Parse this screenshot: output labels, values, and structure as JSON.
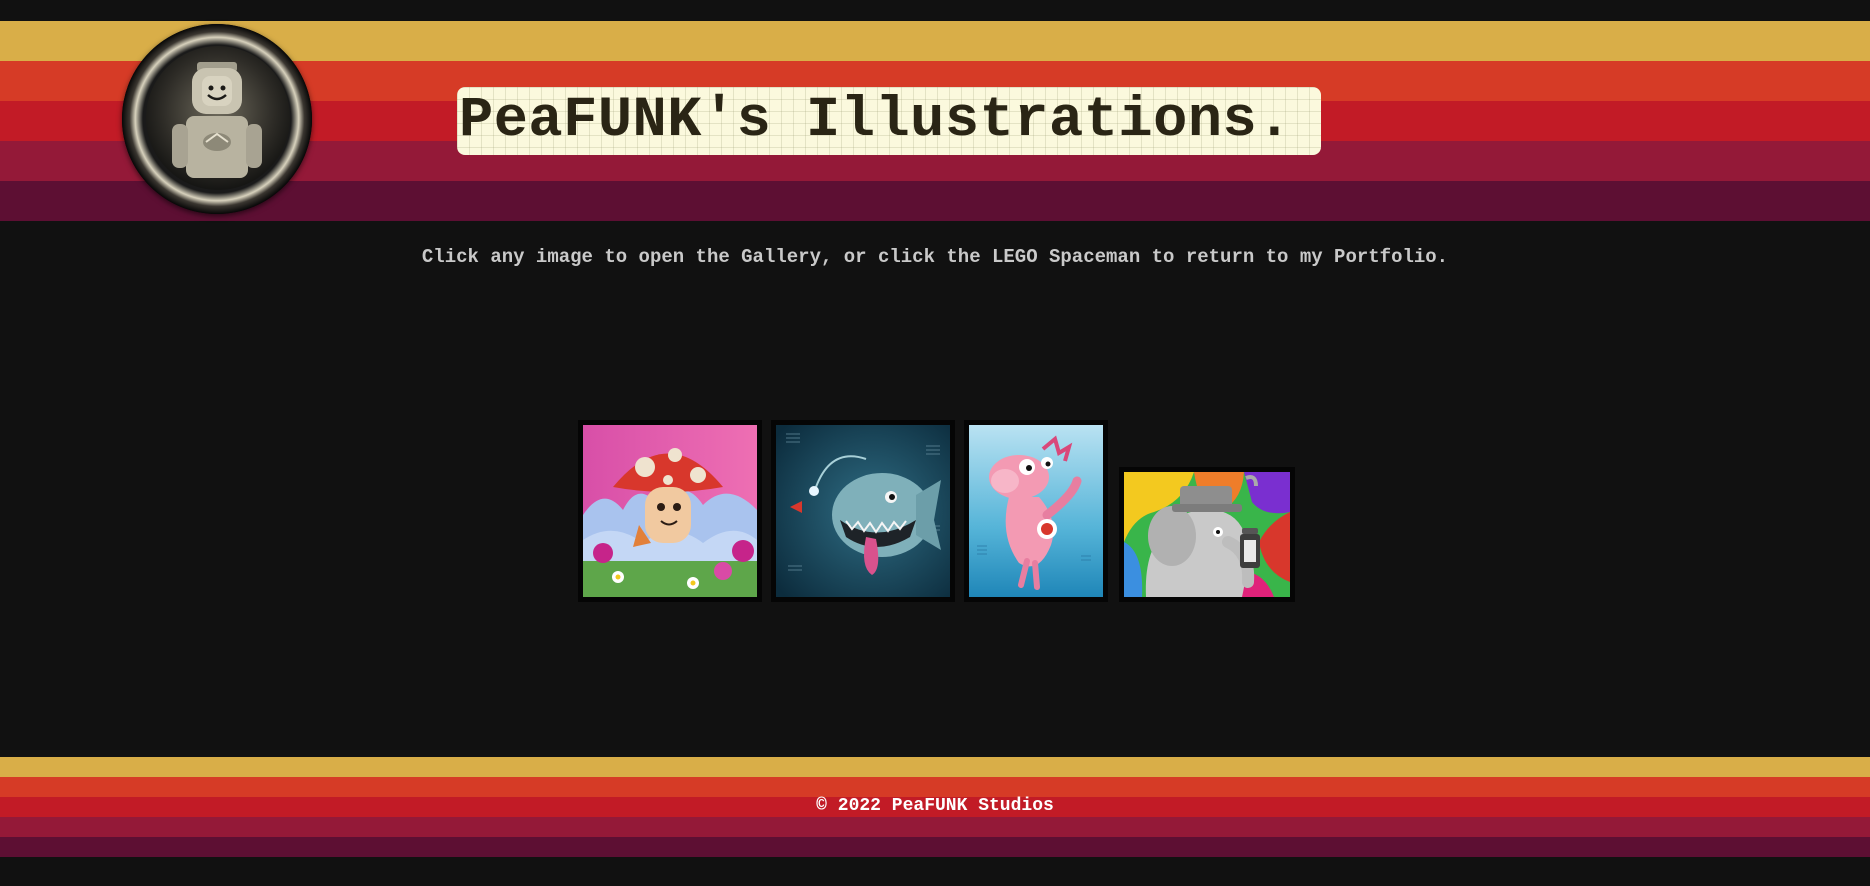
{
  "header": {
    "title": "PeaFUNK's Illustrations.",
    "stripe_colors": [
      "#d9ae48",
      "#d63b26",
      "#c21b26",
      "#941938",
      "#5d0f33"
    ]
  },
  "instruction": "Click any image to open the Gallery, or click the LEGO Spaceman to return to my Portfolio.",
  "gallery": {
    "items": [
      {
        "subject": "mushroom-character"
      },
      {
        "subject": "anglerfish"
      },
      {
        "subject": "pink-axolotl-dinosaur"
      },
      {
        "subject": "steampunk-elephant-with-lantern"
      }
    ]
  },
  "footer": {
    "copyright": "© 2022 PeaFUNK Studios"
  },
  "colors": {
    "background": "#111111",
    "title_box": "#fbf9dd",
    "title_text": "#2a2515",
    "instruction_text": "#c9c9c9"
  }
}
